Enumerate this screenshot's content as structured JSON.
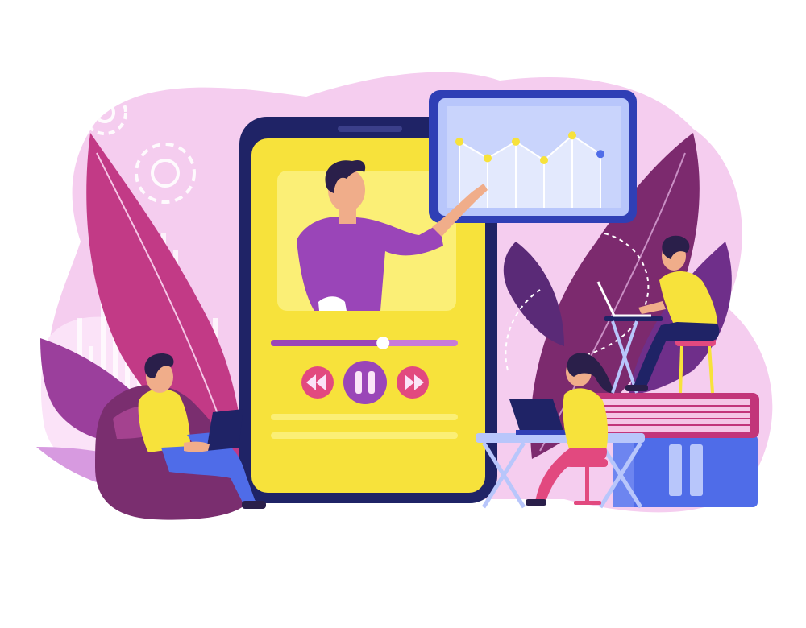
{
  "scene": {
    "theme": "online education video lesson illustration",
    "colors": {
      "background": "#ffffff",
      "blob_pink": "#f3c3ef",
      "blob_light": "#f8dcf5",
      "purple": "#8a3fa8",
      "deep_purple": "#3d1c6e",
      "magenta": "#c2357a",
      "navy": "#1f2366",
      "yellow": "#f7e23b",
      "yellow_light": "#fbef76",
      "blue": "#4f6ce8",
      "blue_light": "#b8c6fb",
      "skin": "#f0ad8a",
      "hair": "#2a1f4a"
    }
  },
  "player": {
    "progress": 0.6,
    "controls": [
      "rewind-icon",
      "pause-icon",
      "fast-forward-icon"
    ]
  },
  "monitor": {
    "chart_points": [
      3.2,
      2.4,
      3.2,
      2.3,
      3.5,
      2.6
    ]
  }
}
